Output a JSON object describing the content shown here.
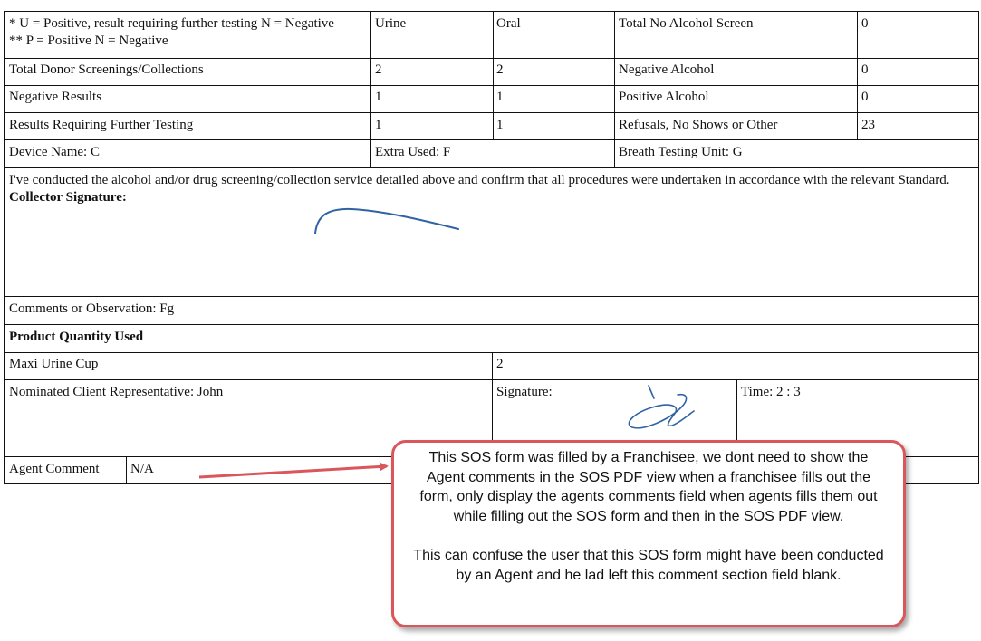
{
  "legend": {
    "line1": "* U = Positive, result requiring further testing N = Negative",
    "line2": "** P = Positive N = Negative"
  },
  "headers": {
    "col_urine": "Urine",
    "col_oral": "Oral"
  },
  "left_rows": [
    {
      "label": "Total Donor Screenings/Collections",
      "urine": "2",
      "oral": "2"
    },
    {
      "label": "Negative Results",
      "urine": "1",
      "oral": "1"
    },
    {
      "label": "Results Requiring Further Testing",
      "urine": "1",
      "oral": "1"
    }
  ],
  "right_rows": [
    {
      "label": "Total No Alcohol Screen",
      "value": "0"
    },
    {
      "label": "Negative Alcohol",
      "value": "0"
    },
    {
      "label": "Positive Alcohol",
      "value": "0"
    },
    {
      "label": "Refusals, No Shows or Other",
      "value": "23"
    }
  ],
  "devices": {
    "device_name": "Device Name: C",
    "extra_used": "Extra Used: F",
    "breath_unit": "Breath Testing Unit: G"
  },
  "declaration": {
    "text": "I've conducted the alcohol and/or drug screening/collection service detailed above and confirm that all procedures were undertaken in accordance with the relevant Standard.",
    "signature_label": "Collector Signature:"
  },
  "comments": "Comments or Observation: Fg",
  "product": {
    "heading": "Product Quantity Used",
    "item_label": "Maxi Urine Cup",
    "item_qty": "2"
  },
  "client": {
    "representative": "Nominated Client Representative: John",
    "signature_label": "Signature:",
    "time": "Time: 2 : 3"
  },
  "agent": {
    "label": "Agent Comment",
    "value": "N/A"
  },
  "callout": {
    "paragraph1": "This SOS form was filled by a Franchisee, we dont need to show the Agent comments in the SOS PDF view when a franchisee fills out the form, only display the agents comments field when agents fills them out while filling out the SOS form and then in the SOS PDF view.",
    "paragraph2": "This can confuse the user that this SOS form might have been conducted by an Agent and he lad left this comment section field blank."
  },
  "colors": {
    "border": "#111111",
    "callout_border": "#d9565a",
    "arrow": "#d9565a",
    "signature_ink": "#2f63a4"
  }
}
